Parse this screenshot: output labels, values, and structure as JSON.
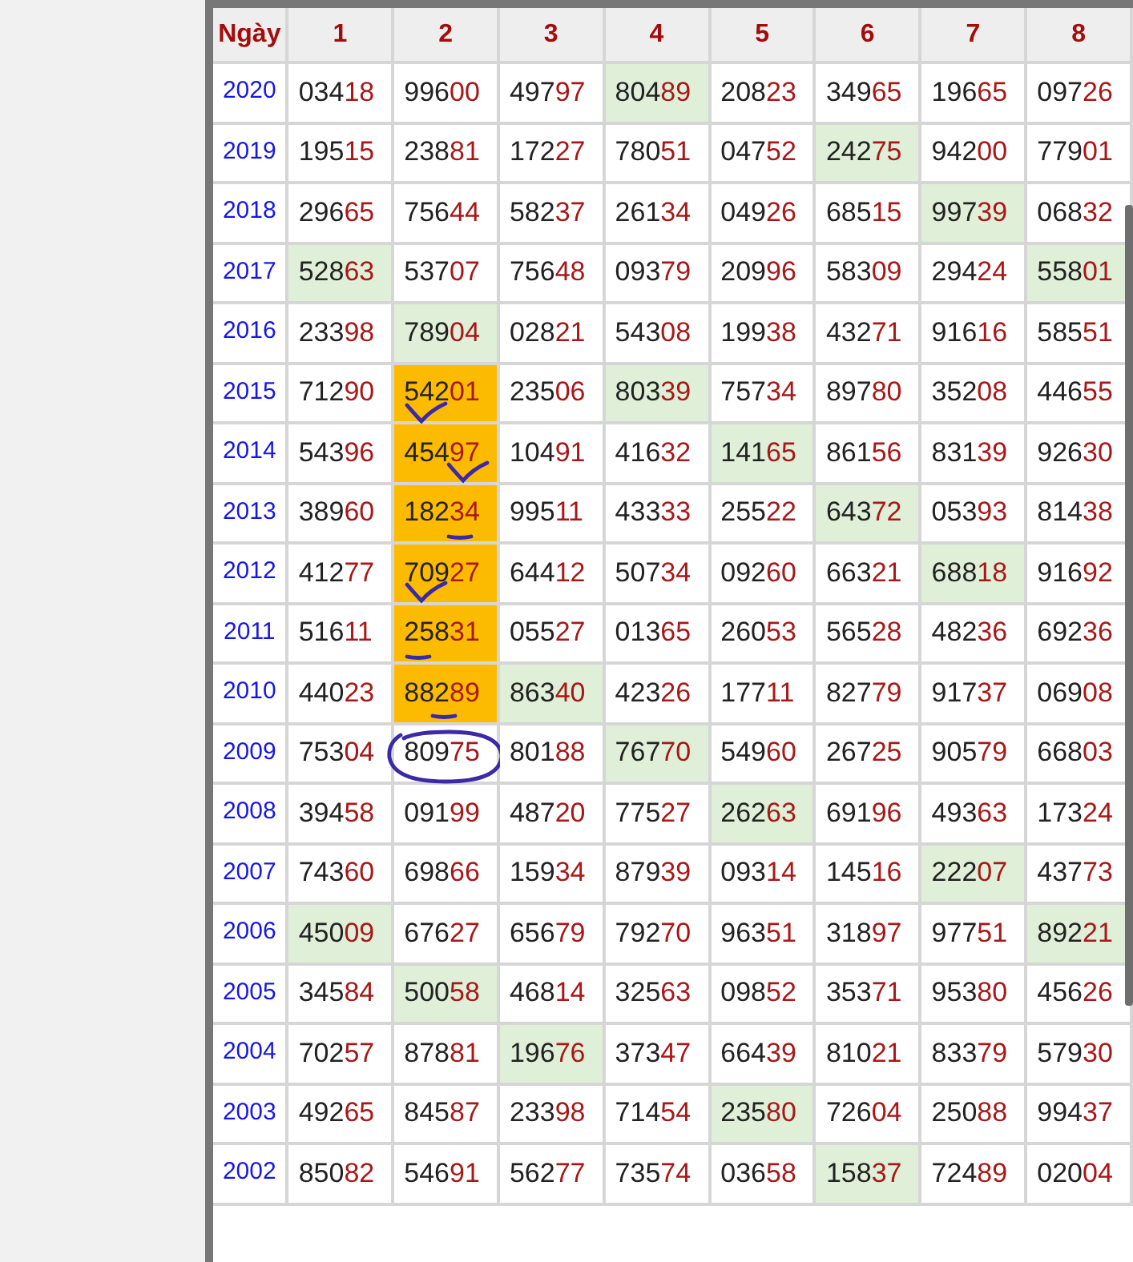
{
  "table": {
    "year_header": "Ngày",
    "columns": [
      "1",
      "2",
      "3",
      "4",
      "5",
      "6",
      "7",
      "8"
    ],
    "rows": [
      {
        "year": "2020",
        "cells": [
          {
            "lead": "034",
            "tail": "18",
            "kind": "plain"
          },
          {
            "lead": "996",
            "tail": "00",
            "kind": "plain"
          },
          {
            "lead": "497",
            "tail": "97",
            "kind": "plain"
          },
          {
            "lead": "804",
            "tail": "89",
            "kind": "hit"
          },
          {
            "lead": "208",
            "tail": "23",
            "kind": "plain"
          },
          {
            "lead": "349",
            "tail": "65",
            "kind": "plain"
          },
          {
            "lead": "196",
            "tail": "65",
            "kind": "plain"
          },
          {
            "lead": "097",
            "tail": "26",
            "kind": "plain"
          }
        ]
      },
      {
        "year": "2019",
        "cells": [
          {
            "lead": "195",
            "tail": "15",
            "kind": "plain"
          },
          {
            "lead": "238",
            "tail": "81",
            "kind": "plain"
          },
          {
            "lead": "172",
            "tail": "27",
            "kind": "plain"
          },
          {
            "lead": "780",
            "tail": "51",
            "kind": "plain"
          },
          {
            "lead": "047",
            "tail": "52",
            "kind": "plain"
          },
          {
            "lead": "242",
            "tail": "75",
            "kind": "hit"
          },
          {
            "lead": "942",
            "tail": "00",
            "kind": "plain"
          },
          {
            "lead": "779",
            "tail": "01",
            "kind": "plain"
          }
        ]
      },
      {
        "year": "2018",
        "cells": [
          {
            "lead": "296",
            "tail": "65",
            "kind": "plain"
          },
          {
            "lead": "756",
            "tail": "44",
            "kind": "plain"
          },
          {
            "lead": "582",
            "tail": "37",
            "kind": "plain"
          },
          {
            "lead": "261",
            "tail": "34",
            "kind": "plain"
          },
          {
            "lead": "049",
            "tail": "26",
            "kind": "plain"
          },
          {
            "lead": "685",
            "tail": "15",
            "kind": "plain"
          },
          {
            "lead": "997",
            "tail": "39",
            "kind": "hit"
          },
          {
            "lead": "068",
            "tail": "32",
            "kind": "plain"
          }
        ]
      },
      {
        "year": "2017",
        "cells": [
          {
            "lead": "528",
            "tail": "63",
            "kind": "hit"
          },
          {
            "lead": "537",
            "tail": "07",
            "kind": "plain"
          },
          {
            "lead": "756",
            "tail": "48",
            "kind": "plain"
          },
          {
            "lead": "093",
            "tail": "79",
            "kind": "plain"
          },
          {
            "lead": "209",
            "tail": "96",
            "kind": "plain"
          },
          {
            "lead": "583",
            "tail": "09",
            "kind": "plain"
          },
          {
            "lead": "294",
            "tail": "24",
            "kind": "plain"
          },
          {
            "lead": "558",
            "tail": "01",
            "kind": "hit"
          }
        ]
      },
      {
        "year": "2016",
        "cells": [
          {
            "lead": "233",
            "tail": "98",
            "kind": "plain"
          },
          {
            "lead": "789",
            "tail": "04",
            "kind": "hit"
          },
          {
            "lead": "028",
            "tail": "21",
            "kind": "plain"
          },
          {
            "lead": "543",
            "tail": "08",
            "kind": "plain"
          },
          {
            "lead": "199",
            "tail": "38",
            "kind": "plain"
          },
          {
            "lead": "432",
            "tail": "71",
            "kind": "plain"
          },
          {
            "lead": "916",
            "tail": "16",
            "kind": "plain"
          },
          {
            "lead": "585",
            "tail": "51",
            "kind": "plain"
          }
        ]
      },
      {
        "year": "2015",
        "cells": [
          {
            "lead": "712",
            "tail": "90",
            "kind": "plain"
          },
          {
            "lead": "542",
            "tail": "01",
            "kind": "picked",
            "pen": {
              "kind": "check",
              "on_tail": false
            }
          },
          {
            "lead": "235",
            "tail": "06",
            "kind": "plain"
          },
          {
            "lead": "803",
            "tail": "39",
            "kind": "hit"
          },
          {
            "lead": "757",
            "tail": "34",
            "kind": "plain"
          },
          {
            "lead": "897",
            "tail": "80",
            "kind": "plain"
          },
          {
            "lead": "352",
            "tail": "08",
            "kind": "plain"
          },
          {
            "lead": "446",
            "tail": "55",
            "kind": "plain"
          }
        ]
      },
      {
        "year": "2014",
        "cells": [
          {
            "lead": "543",
            "tail": "96",
            "kind": "plain"
          },
          {
            "lead": "454",
            "tail": "97",
            "kind": "picked",
            "pen": {
              "kind": "check",
              "on_tail": true
            }
          },
          {
            "lead": "104",
            "tail": "91",
            "kind": "plain"
          },
          {
            "lead": "416",
            "tail": "32",
            "kind": "plain"
          },
          {
            "lead": "141",
            "tail": "65",
            "kind": "hit"
          },
          {
            "lead": "861",
            "tail": "56",
            "kind": "plain"
          },
          {
            "lead": "831",
            "tail": "39",
            "kind": "plain"
          },
          {
            "lead": "926",
            "tail": "30",
            "kind": "plain"
          }
        ]
      },
      {
        "year": "2013",
        "cells": [
          {
            "lead": "389",
            "tail": "60",
            "kind": "plain"
          },
          {
            "lead": "182",
            "tail": "34",
            "kind": "picked",
            "pen": {
              "kind": "underline",
              "on_tail": true
            }
          },
          {
            "lead": "995",
            "tail": "11",
            "kind": "plain"
          },
          {
            "lead": "433",
            "tail": "33",
            "kind": "plain"
          },
          {
            "lead": "255",
            "tail": "22",
            "kind": "plain"
          },
          {
            "lead": "643",
            "tail": "72",
            "kind": "hit"
          },
          {
            "lead": "053",
            "tail": "93",
            "kind": "plain"
          },
          {
            "lead": "814",
            "tail": "38",
            "kind": "plain"
          }
        ]
      },
      {
        "year": "2012",
        "cells": [
          {
            "lead": "412",
            "tail": "77",
            "kind": "plain"
          },
          {
            "lead": "709",
            "tail": "27",
            "kind": "picked",
            "pen": {
              "kind": "check",
              "on_tail": false
            }
          },
          {
            "lead": "644",
            "tail": "12",
            "kind": "plain"
          },
          {
            "lead": "507",
            "tail": "34",
            "kind": "plain"
          },
          {
            "lead": "092",
            "tail": "60",
            "kind": "plain"
          },
          {
            "lead": "663",
            "tail": "21",
            "kind": "plain"
          },
          {
            "lead": "688",
            "tail": "18",
            "kind": "hit"
          },
          {
            "lead": "916",
            "tail": "92",
            "kind": "plain"
          }
        ]
      },
      {
        "year": "2011",
        "cells": [
          {
            "lead": "516",
            "tail": "11",
            "kind": "plain"
          },
          {
            "lead": "258",
            "tail": "31",
            "kind": "picked",
            "pen": {
              "kind": "underline",
              "on_tail": false
            }
          },
          {
            "lead": "055",
            "tail": "27",
            "kind": "plain"
          },
          {
            "lead": "013",
            "tail": "65",
            "kind": "plain"
          },
          {
            "lead": "260",
            "tail": "53",
            "kind": "plain"
          },
          {
            "lead": "565",
            "tail": "28",
            "kind": "plain"
          },
          {
            "lead": "482",
            "tail": "36",
            "kind": "plain"
          },
          {
            "lead": "692",
            "tail": "36",
            "kind": "plain"
          }
        ]
      },
      {
        "year": "2010",
        "cells": [
          {
            "lead": "440",
            "tail": "23",
            "kind": "plain"
          },
          {
            "lead": "882",
            "tail": "89",
            "kind": "picked",
            "pen": {
              "kind": "underline",
              "on_tail": false
            }
          },
          {
            "lead": "863",
            "tail": "40",
            "kind": "hit"
          },
          {
            "lead": "423",
            "tail": "26",
            "kind": "plain"
          },
          {
            "lead": "177",
            "tail": "11",
            "kind": "plain"
          },
          {
            "lead": "827",
            "tail": "79",
            "kind": "plain"
          },
          {
            "lead": "917",
            "tail": "37",
            "kind": "plain"
          },
          {
            "lead": "069",
            "tail": "08",
            "kind": "plain"
          }
        ]
      },
      {
        "year": "2009",
        "cells": [
          {
            "lead": "753",
            "tail": "04",
            "kind": "plain"
          },
          {
            "lead": "809",
            "tail": "75",
            "kind": "plain",
            "pen": {
              "kind": "circle"
            }
          },
          {
            "lead": "801",
            "tail": "88",
            "kind": "plain"
          },
          {
            "lead": "767",
            "tail": "70",
            "kind": "hit"
          },
          {
            "lead": "549",
            "tail": "60",
            "kind": "plain"
          },
          {
            "lead": "267",
            "tail": "25",
            "kind": "plain"
          },
          {
            "lead": "905",
            "tail": "79",
            "kind": "plain"
          },
          {
            "lead": "668",
            "tail": "03",
            "kind": "plain"
          }
        ]
      },
      {
        "year": "2008",
        "cells": [
          {
            "lead": "394",
            "tail": "58",
            "kind": "plain"
          },
          {
            "lead": "091",
            "tail": "99",
            "kind": "plain"
          },
          {
            "lead": "487",
            "tail": "20",
            "kind": "plain"
          },
          {
            "lead": "775",
            "tail": "27",
            "kind": "plain"
          },
          {
            "lead": "262",
            "tail": "63",
            "kind": "hit"
          },
          {
            "lead": "691",
            "tail": "96",
            "kind": "plain"
          },
          {
            "lead": "493",
            "tail": "63",
            "kind": "plain"
          },
          {
            "lead": "173",
            "tail": "24",
            "kind": "plain"
          }
        ]
      },
      {
        "year": "2007",
        "cells": [
          {
            "lead": "743",
            "tail": "60",
            "kind": "plain"
          },
          {
            "lead": "698",
            "tail": "66",
            "kind": "plain"
          },
          {
            "lead": "159",
            "tail": "34",
            "kind": "plain"
          },
          {
            "lead": "879",
            "tail": "39",
            "kind": "plain"
          },
          {
            "lead": "093",
            "tail": "14",
            "kind": "plain"
          },
          {
            "lead": "145",
            "tail": "16",
            "kind": "plain"
          },
          {
            "lead": "222",
            "tail": "07",
            "kind": "hit"
          },
          {
            "lead": "437",
            "tail": "73",
            "kind": "plain"
          }
        ]
      },
      {
        "year": "2006",
        "cells": [
          {
            "lead": "450",
            "tail": "09",
            "kind": "hit"
          },
          {
            "lead": "676",
            "tail": "27",
            "kind": "plain"
          },
          {
            "lead": "656",
            "tail": "79",
            "kind": "plain"
          },
          {
            "lead": "792",
            "tail": "70",
            "kind": "plain"
          },
          {
            "lead": "963",
            "tail": "51",
            "kind": "plain"
          },
          {
            "lead": "318",
            "tail": "97",
            "kind": "plain"
          },
          {
            "lead": "977",
            "tail": "51",
            "kind": "plain"
          },
          {
            "lead": "892",
            "tail": "21",
            "kind": "hit"
          }
        ]
      },
      {
        "year": "2005",
        "cells": [
          {
            "lead": "345",
            "tail": "84",
            "kind": "plain"
          },
          {
            "lead": "500",
            "tail": "58",
            "kind": "hit"
          },
          {
            "lead": "468",
            "tail": "14",
            "kind": "plain"
          },
          {
            "lead": "325",
            "tail": "63",
            "kind": "plain"
          },
          {
            "lead": "098",
            "tail": "52",
            "kind": "plain"
          },
          {
            "lead": "353",
            "tail": "71",
            "kind": "plain"
          },
          {
            "lead": "953",
            "tail": "80",
            "kind": "plain"
          },
          {
            "lead": "456",
            "tail": "26",
            "kind": "plain"
          }
        ]
      },
      {
        "year": "2004",
        "cells": [
          {
            "lead": "702",
            "tail": "57",
            "kind": "plain"
          },
          {
            "lead": "878",
            "tail": "81",
            "kind": "plain"
          },
          {
            "lead": "196",
            "tail": "76",
            "kind": "hit"
          },
          {
            "lead": "373",
            "tail": "47",
            "kind": "plain"
          },
          {
            "lead": "664",
            "tail": "39",
            "kind": "plain"
          },
          {
            "lead": "810",
            "tail": "21",
            "kind": "plain"
          },
          {
            "lead": "833",
            "tail": "79",
            "kind": "plain"
          },
          {
            "lead": "579",
            "tail": "30",
            "kind": "plain"
          }
        ]
      },
      {
        "year": "2003",
        "cells": [
          {
            "lead": "492",
            "tail": "65",
            "kind": "plain"
          },
          {
            "lead": "845",
            "tail": "87",
            "kind": "plain"
          },
          {
            "lead": "233",
            "tail": "98",
            "kind": "plain"
          },
          {
            "lead": "714",
            "tail": "54",
            "kind": "plain"
          },
          {
            "lead": "235",
            "tail": "80",
            "kind": "hit"
          },
          {
            "lead": "726",
            "tail": "04",
            "kind": "plain"
          },
          {
            "lead": "250",
            "tail": "88",
            "kind": "plain"
          },
          {
            "lead": "994",
            "tail": "37",
            "kind": "plain"
          }
        ]
      },
      {
        "year": "2002",
        "cells": [
          {
            "lead": "850",
            "tail": "82",
            "kind": "plain"
          },
          {
            "lead": "546",
            "tail": "91",
            "kind": "plain"
          },
          {
            "lead": "562",
            "tail": "77",
            "kind": "plain"
          },
          {
            "lead": "735",
            "tail": "74",
            "kind": "plain"
          },
          {
            "lead": "036",
            "tail": "58",
            "kind": "plain"
          },
          {
            "lead": "158",
            "tail": "37",
            "kind": "hit"
          },
          {
            "lead": "724",
            "tail": "89",
            "kind": "plain"
          },
          {
            "lead": "020",
            "tail": "04",
            "kind": "plain"
          }
        ]
      }
    ]
  }
}
